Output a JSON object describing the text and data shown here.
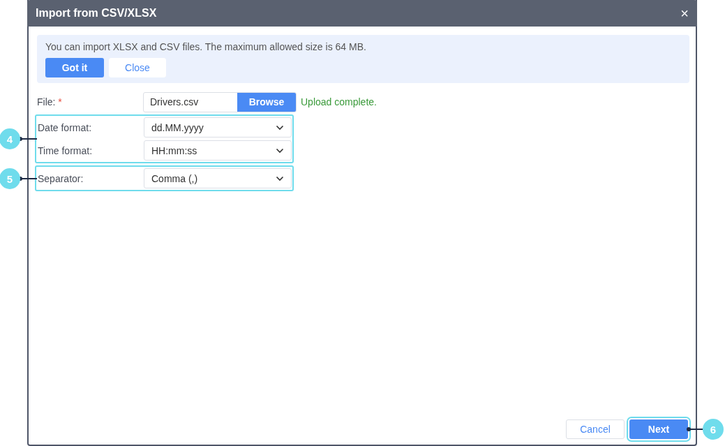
{
  "window": {
    "title": "Import from CSV/XLSX",
    "close": "×"
  },
  "notice": {
    "text": "You can import XLSX and CSV files. The maximum allowed size is 64 MB.",
    "buttons": [
      {
        "label": "Got it",
        "kind": "primary"
      },
      {
        "label": "Close",
        "kind": "plain"
      }
    ]
  },
  "file": {
    "label": "File:",
    "required": "*",
    "value": "Drivers.csv",
    "button": "Browse",
    "status": "Upload complete."
  },
  "groups": [
    {
      "callout": "4",
      "fields": [
        {
          "label": "Date format:",
          "value": "dd.MM.yyyy"
        },
        {
          "label": "Time format:",
          "value": "HH:mm:ss"
        }
      ]
    },
    {
      "callout": "5",
      "fields": [
        {
          "label": "Separator:",
          "value": "Comma (,)"
        }
      ]
    }
  ],
  "footer": {
    "buttons": [
      {
        "label": "Cancel",
        "kind": "plain",
        "highlighted": false
      },
      {
        "label": "Next",
        "kind": "primary",
        "highlighted": true,
        "callout": "6"
      }
    ]
  }
}
